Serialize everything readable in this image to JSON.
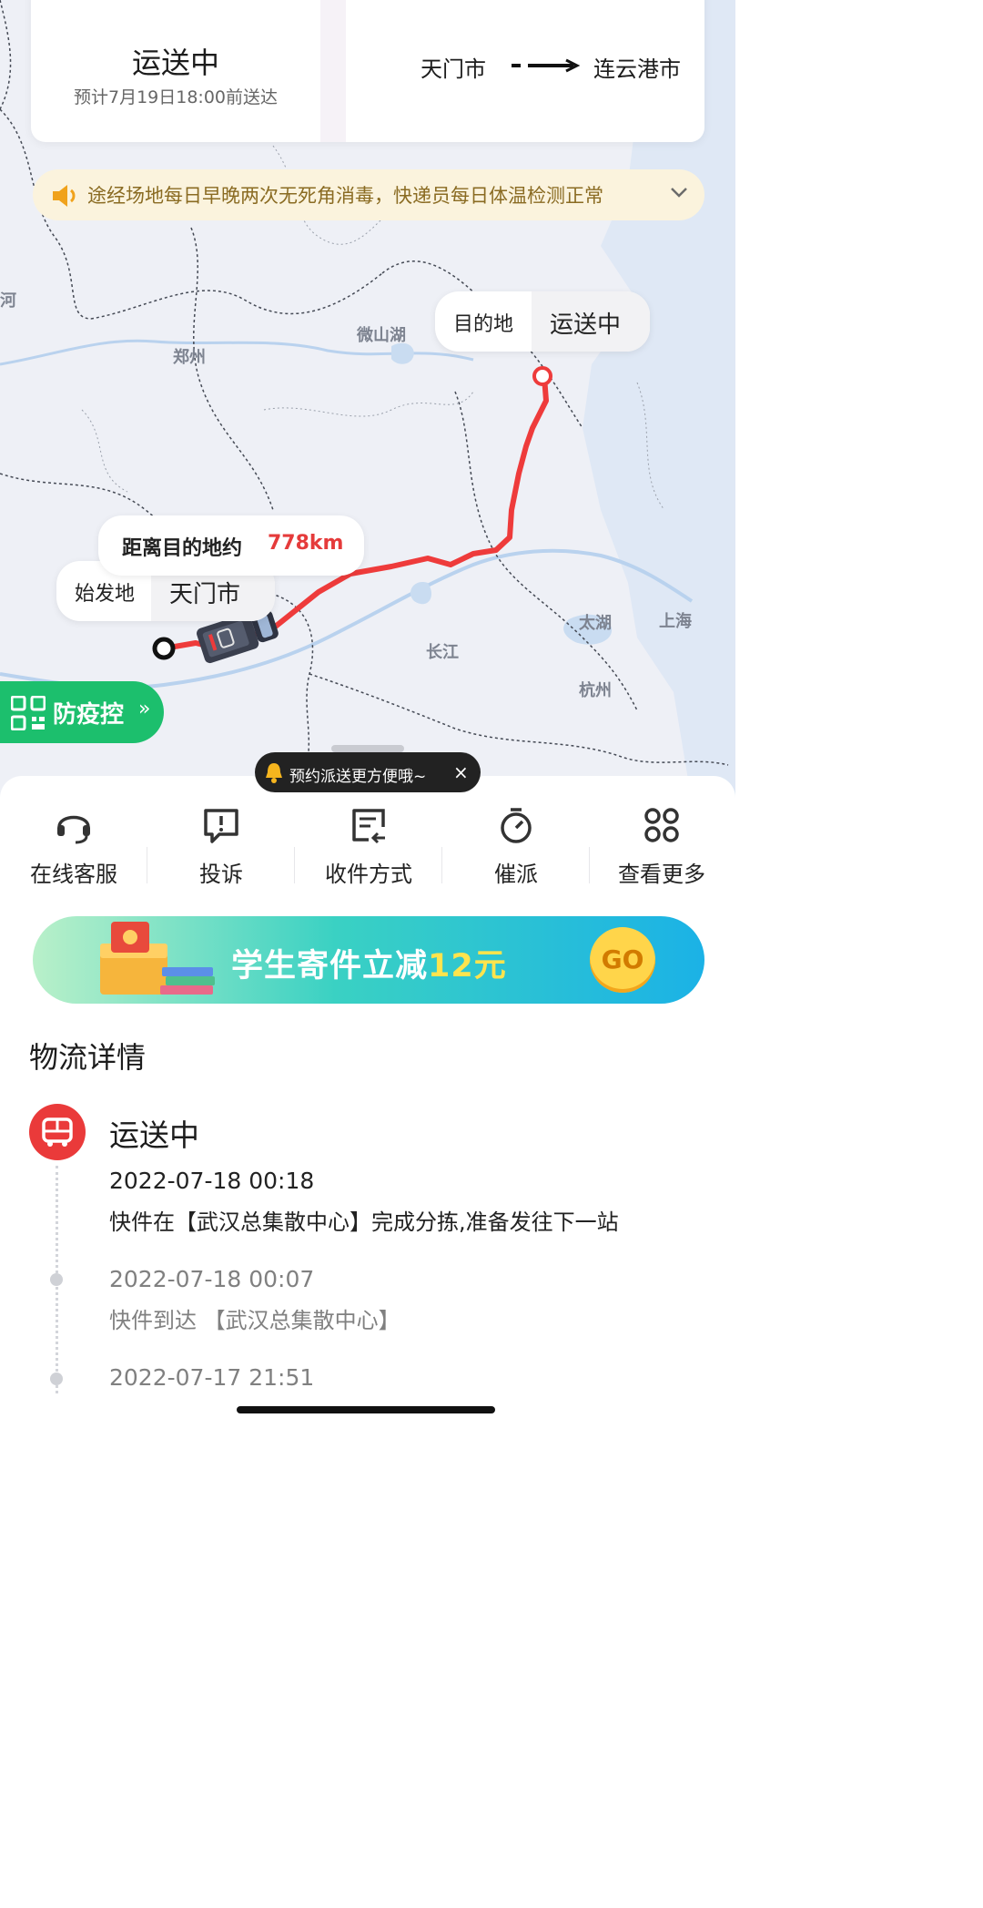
{
  "status": {
    "title": "运送中",
    "eta": "预计7月19日18:00前送达",
    "from_city": "天门市",
    "to_city": "连云港市"
  },
  "notice": {
    "text": "途经场地每日早晚两次无死角消毒，快递员每日体温检测正常",
    "icon": "speaker-icon"
  },
  "map": {
    "labels": [
      "河",
      "郑州",
      "微山湖",
      "长江",
      "太湖",
      "上海",
      "杭州"
    ],
    "route_color": "#ee3b3b",
    "destination": {
      "label": "目的地",
      "value": "运送中"
    },
    "distance": {
      "label": "距离目的地约",
      "value": "778km"
    },
    "origin": {
      "label": "始发地",
      "value": "天门市"
    }
  },
  "epidemic_button": {
    "label": "防疫控",
    "arrow": "»"
  },
  "tooltip": {
    "text": "预约派送更方便哦~",
    "close": "×"
  },
  "actions": [
    {
      "label": "在线客服",
      "icon": "headset-icon"
    },
    {
      "label": "投诉",
      "icon": "complaint-icon"
    },
    {
      "label": "收件方式",
      "icon": "receive-method-icon"
    },
    {
      "label": "催派",
      "icon": "stopwatch-icon"
    },
    {
      "label": "查看更多",
      "icon": "more-grid-icon"
    }
  ],
  "banner": {
    "text_prefix": "学生寄件立减",
    "text_highlight": "12元",
    "go": "GO"
  },
  "logistics": {
    "title": "物流详情",
    "current_status": "运送中",
    "events": [
      {
        "time": "2022-07-18 00:18",
        "desc": "快件在【武汉总集散中心】完成分拣,准备发往下一站"
      },
      {
        "time": "2022-07-18 00:07",
        "desc": "快件到达 【武汉总集散中心】"
      },
      {
        "time": "2022-07-17 21:51",
        "desc": ""
      }
    ]
  },
  "colors": {
    "accent_red": "#ea3a3a",
    "green": "#1cbf6d",
    "notice_bg": "#fbf3dd"
  }
}
